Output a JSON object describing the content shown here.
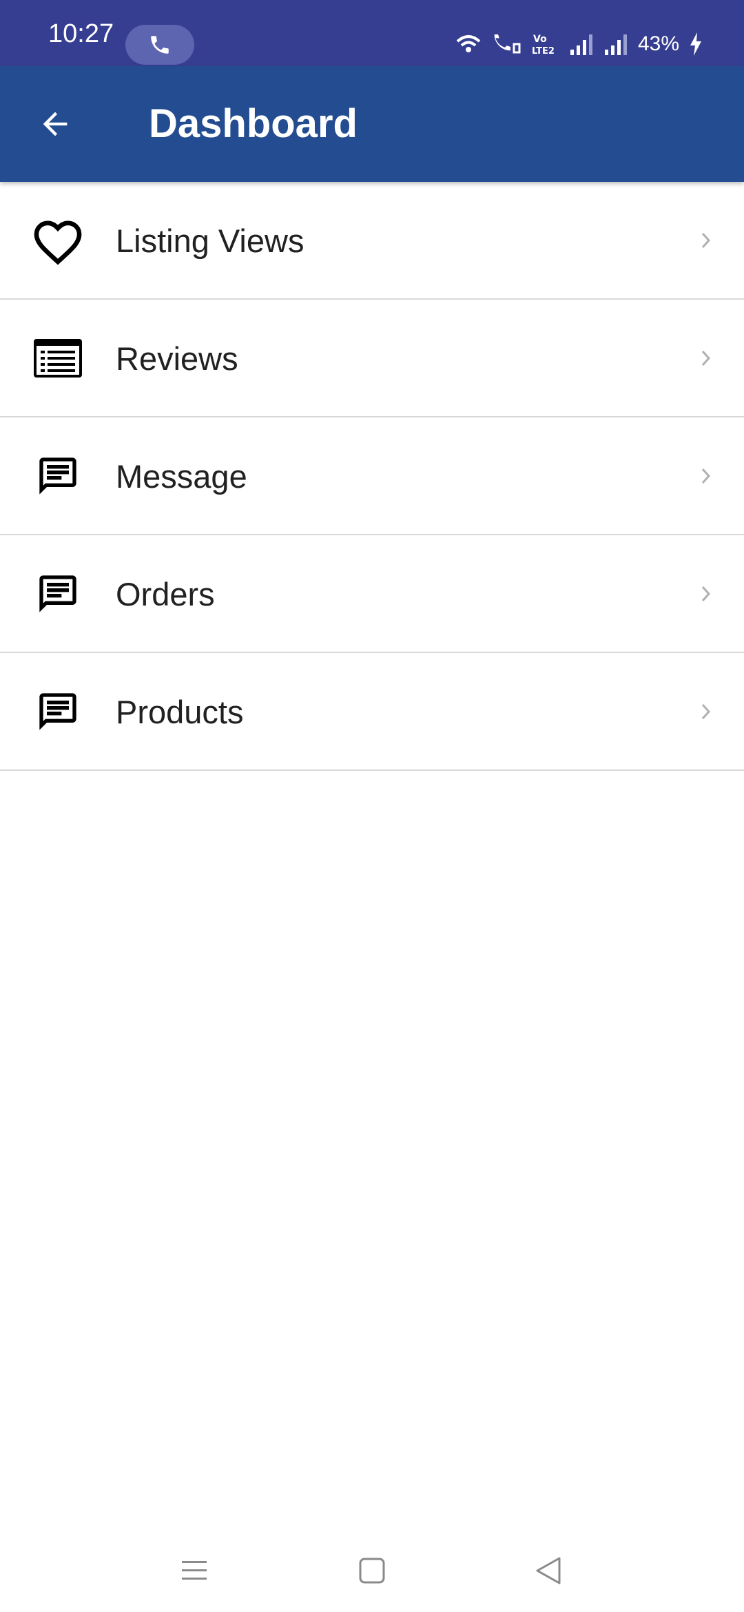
{
  "status_bar": {
    "time": "10:27",
    "battery": "43%",
    "icons": [
      "phone-call-icon",
      "wifi-icon",
      "wifi-calling-icon",
      "volte-icon",
      "signal-icon",
      "signal-icon",
      "charging-icon"
    ]
  },
  "app_bar": {
    "title": "Dashboard",
    "back_icon": "arrow-left-icon"
  },
  "menu": {
    "items": [
      {
        "label": "Listing Views",
        "icon": "heart-icon"
      },
      {
        "label": "Reviews",
        "icon": "list-icon"
      },
      {
        "label": "Message",
        "icon": "message-icon"
      },
      {
        "label": "Orders",
        "icon": "message-icon"
      },
      {
        "label": "Products",
        "icon": "message-icon"
      }
    ]
  },
  "nav_bar": {
    "icons": [
      "menu-icon",
      "home-icon",
      "back-icon"
    ]
  },
  "colors": {
    "status_bar": "#363e91",
    "app_bar": "#244c91",
    "text": "#212121",
    "divider": "#d9d9d9",
    "chevron": "#b0b0b0"
  }
}
